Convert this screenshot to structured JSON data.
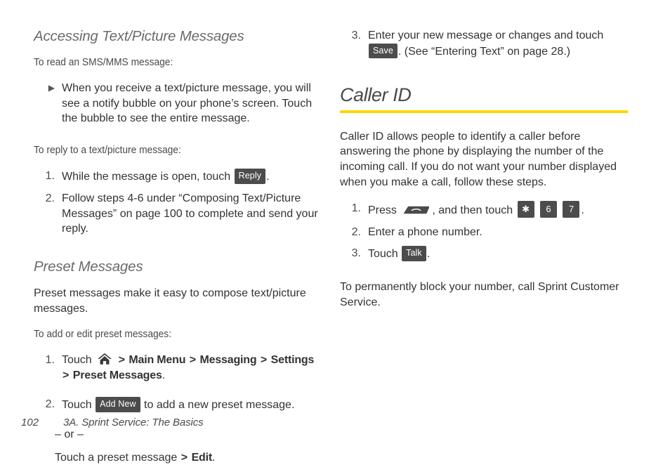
{
  "colors": {
    "accent_rule": "#ffd400",
    "chip_background": "#4c4c4c",
    "chip_text": "#ffffff",
    "heading_gray": "#4a4a4a",
    "subheading_gray": "#6b6b6b",
    "body_text": "#333333"
  },
  "left_column": {
    "heading": "Accessing Text/Picture Messages",
    "lead_read": "To read an SMS/MMS message:",
    "bullet_read": {
      "marker": "▶",
      "text": "When you receive a text/picture message, you will see a notify bubble on your phone’s screen. Touch the bubble to see the entire message."
    },
    "lead_reply": "To reply to a text/picture message:",
    "reply_steps": [
      {
        "marker": "1.",
        "text_before": "While the message is open, touch",
        "chip": "Reply",
        "text_after": "."
      },
      {
        "marker": "2.",
        "text_before": "Follow steps 4-6 under “Composing Text/Picture Messages” on page 100 to complete and send your reply.",
        "chip": "",
        "text_after": ""
      }
    ],
    "subheading": "Preset Messages",
    "preset_intro": "Preset messages make it easy to compose text/picture messages.",
    "lead_preset": "To add or edit preset messages:",
    "preset_steps": [
      {
        "marker": "1.",
        "text_before": "Touch",
        "icon": "home-icon",
        "nav_path": [
          "Main Menu",
          "Messaging",
          "Settings",
          "Preset Messages"
        ],
        "separator": ">",
        "text_after": "."
      },
      {
        "marker": "2.",
        "text_before": "Touch",
        "chip": "Add New",
        "text_after": "to add a new preset message."
      }
    ],
    "or_divider": "– or –",
    "edit_line_before": "Touch a preset message",
    "edit_separator": ">",
    "edit_bold": "Edit",
    "edit_line_after": "."
  },
  "right_column": {
    "continued_step": {
      "marker": "3.",
      "text_before": "Enter your new message or changes and touch",
      "chip": "Save",
      "text_after": ". (See “Entering Text” on page 28.)"
    },
    "heading": "Caller ID",
    "intro": "Caller ID allows people to identify a caller before answering the phone by displaying the number of the incoming call. If you do not want your number displayed when you make a call, follow these steps.",
    "steps": [
      {
        "marker": "1.",
        "text_before": "Press",
        "icon": "talk-key-icon",
        "text_middle": ", and then touch",
        "keys": [
          "✱",
          "6",
          "7"
        ],
        "text_after": "."
      },
      {
        "marker": "2.",
        "text_before": "Enter a phone number.",
        "keys": [],
        "text_after": ""
      },
      {
        "marker": "3.",
        "text_before": "Touch",
        "chip": "Talk",
        "text_after": "."
      }
    ],
    "closing": "To permanently block your number, call Sprint Customer Service."
  },
  "footer": {
    "page_number": "102",
    "title": "3A. Sprint Service: The Basics"
  }
}
